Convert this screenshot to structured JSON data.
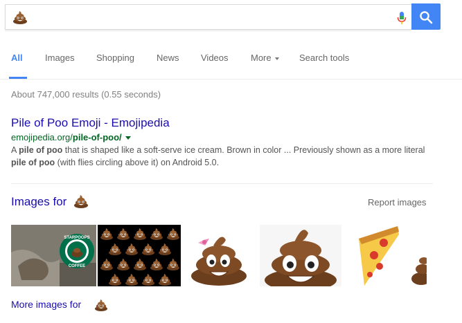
{
  "search": {
    "query_emoji": "pile-of-poo-emoji",
    "mic": "mic-icon",
    "button": "search-icon"
  },
  "tabs": [
    {
      "label": "All",
      "active": true
    },
    {
      "label": "Images"
    },
    {
      "label": "Shopping"
    },
    {
      "label": "News"
    },
    {
      "label": "Videos"
    },
    {
      "label": "More"
    },
    {
      "label": "Search tools"
    }
  ],
  "result_stats": "About 747,000 results (0.55 seconds)",
  "result": {
    "title": "Pile of Poo Emoji - Emojipedia",
    "url_prefix": "emojipedia.org/",
    "url_bold": "pile-of-poo/",
    "snippet_a": "A ",
    "snippet_b1": "pile of poo",
    "snippet_c": " that is shaped like a soft-serve ice cream. Brown in color ... Previously shown as a more literal ",
    "snippet_b2": "pile of poo",
    "snippet_d": " (with flies circling above it) on Android 5.0."
  },
  "images": {
    "heading": "Images for",
    "report": "Report images",
    "more": "More images for",
    "thumb_logo_text_top": "STARPOOPS",
    "thumb_logo_text_bottom": "COFFEE"
  },
  "colors": {
    "link": "#1a0dab",
    "url": "#006621",
    "accent": "#4285f4",
    "poo_brown": "#7b4a23"
  }
}
